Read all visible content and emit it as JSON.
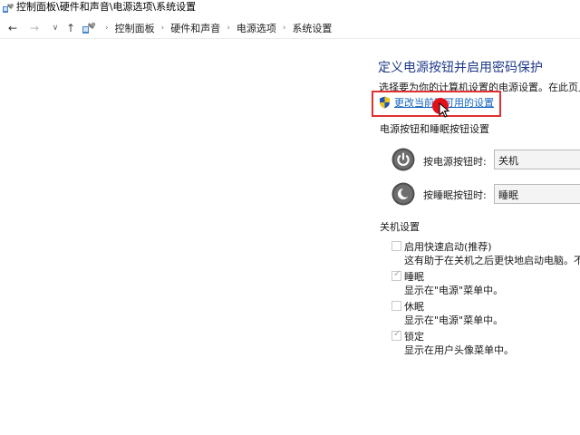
{
  "window": {
    "title": "控制面板\\硬件和声音\\电源选项\\系统设置"
  },
  "address_bar": {
    "back": "←",
    "forward": "→",
    "recent": "∨",
    "up": "↑",
    "breadcrumbs": [
      "控制面板",
      "硬件和声音",
      "电源选项",
      "系统设置"
    ],
    "separator": "›"
  },
  "content": {
    "title": "定义电源按钮并启用密码保护",
    "description": "选择要为你的计算机设置的电源设置。在此页上",
    "change_link": "更改当前不可用的设置"
  },
  "power_buttons": {
    "section_title": "电源按钮和睡眠按钮设置",
    "power_label": "按电源按钮时:",
    "power_value": "关机",
    "sleep_label": "按睡眠按钮时:",
    "sleep_value": "睡眠"
  },
  "shutdown": {
    "section_title": "关机设置",
    "options": [
      {
        "label": "启用快速启动(推荐)",
        "desc": "这有助于在关机之后更快地启动电脑。不会",
        "checked": false
      },
      {
        "label": "睡眠",
        "desc": "显示在\"电源\"菜单中。",
        "checked": true
      },
      {
        "label": "休眠",
        "desc": "显示在\"电源\"菜单中。",
        "checked": false
      },
      {
        "label": "锁定",
        "desc": "显示在用户头像菜单中。",
        "checked": true
      }
    ]
  },
  "colors": {
    "highlight": "#e03030",
    "cursor": "#e3101a",
    "title": "#1e3a8a",
    "link": "#1565c0"
  }
}
